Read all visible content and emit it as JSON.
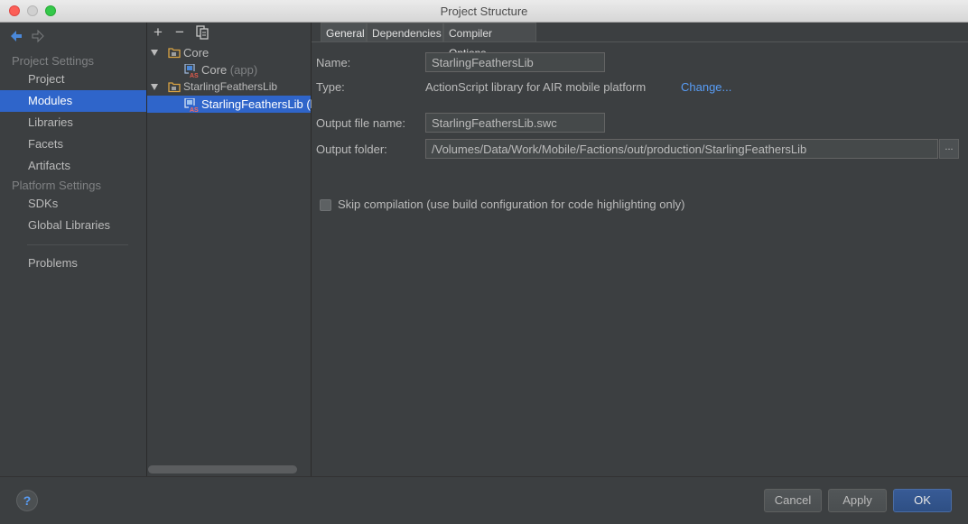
{
  "window": {
    "title": "Project Structure"
  },
  "sidebar": {
    "project_settings_header": "Project Settings",
    "items_project": [
      "Project",
      "Modules",
      "Libraries",
      "Facets",
      "Artifacts"
    ],
    "platform_settings_header": "Platform Settings",
    "items_platform": [
      "SDKs",
      "Global Libraries"
    ],
    "problems": "Problems",
    "selected": "Modules"
  },
  "tree": {
    "toolbar": {
      "add": "+",
      "remove": "−"
    },
    "nodes": [
      {
        "label": "Core",
        "hint": "",
        "expanded": true
      },
      {
        "label": "Core",
        "hint": " (app)"
      },
      {
        "label": "StarlingFeathersLib",
        "hint": "",
        "expanded": true
      },
      {
        "label": "StarlingFeathersLib (li",
        "hint": "",
        "selected": true
      }
    ]
  },
  "tabs": [
    "General",
    "Dependencies",
    "Compiler Options"
  ],
  "active_tab": "General",
  "form": {
    "name_label": "Name:",
    "name_value": "StarlingFeathersLib",
    "type_label": "Type:",
    "type_value": "ActionScript library for AIR mobile platform",
    "change_link": "Change...",
    "output_file_label": "Output file name:",
    "output_file_value": "StarlingFeathersLib.swc",
    "output_folder_label": "Output folder:",
    "output_folder_value": "/Volumes/Data/Work/Mobile/Factions/out/production/StarlingFeathersLib",
    "browse_label": "...",
    "skip_compilation_label": "Skip compilation (use build configuration for code highlighting only)",
    "skip_compilation_checked": false
  },
  "footer": {
    "help": "?",
    "cancel": "Cancel",
    "apply": "Apply",
    "ok": "OK"
  },
  "colors": {
    "accent": "#2f65ca",
    "link": "#589df6",
    "background": "#3c3f41"
  }
}
